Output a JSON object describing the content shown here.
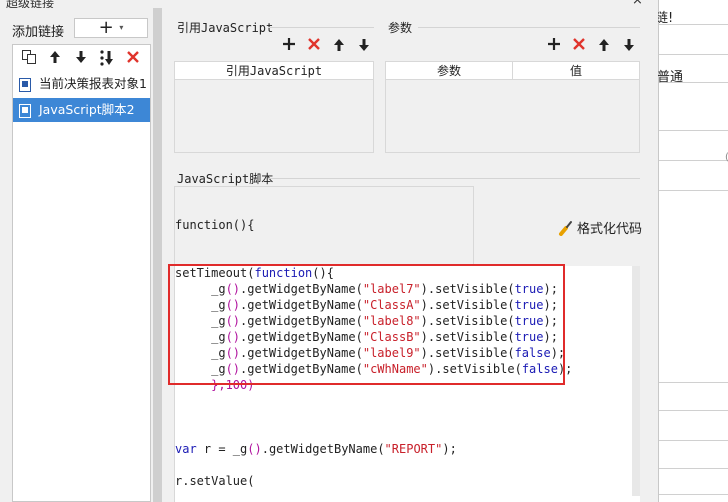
{
  "window": {
    "title": "超级链接",
    "close_symbol": "×"
  },
  "left": {
    "add_link_label": "添加链接",
    "add_button_symbol": "+",
    "add_button_caret": "▾",
    "items": [
      {
        "label": "当前决策报表对象1",
        "selected": false
      },
      {
        "label": "JavaScript脚本2",
        "selected": true
      }
    ]
  },
  "ref_js": {
    "section_label": "引用JavaScript",
    "column_header": "引用JavaScript"
  },
  "params": {
    "section_label": "参数",
    "col_param": "参数",
    "col_value": "值"
  },
  "script": {
    "section_label": "JavaScript脚本",
    "function_header": "function(){",
    "format_button": "格式化代码"
  },
  "code_lines": [
    {
      "segments": [
        {
          "t": "setTimeout(",
          "c": ""
        },
        {
          "t": "function",
          "c": "kw"
        },
        {
          "t": "(){",
          "c": ""
        }
      ]
    },
    {
      "segments": [
        {
          "t": "     _g",
          "c": ""
        },
        {
          "t": "()",
          "c": "pink"
        },
        {
          "t": ".getWidgetByName(",
          "c": ""
        },
        {
          "t": "\"label7\"",
          "c": "str"
        },
        {
          "t": ").setVisible(",
          "c": ""
        },
        {
          "t": "true",
          "c": "kw"
        },
        {
          "t": ");",
          "c": ""
        }
      ]
    },
    {
      "segments": [
        {
          "t": "     _g",
          "c": ""
        },
        {
          "t": "()",
          "c": "pink"
        },
        {
          "t": ".getWidgetByName(",
          "c": ""
        },
        {
          "t": "\"ClassA\"",
          "c": "str"
        },
        {
          "t": ").setVisible(",
          "c": ""
        },
        {
          "t": "true",
          "c": "kw"
        },
        {
          "t": ");",
          "c": ""
        }
      ]
    },
    {
      "segments": [
        {
          "t": "     _g",
          "c": ""
        },
        {
          "t": "()",
          "c": "pink"
        },
        {
          "t": ".getWidgetByName(",
          "c": ""
        },
        {
          "t": "\"label8\"",
          "c": "str"
        },
        {
          "t": ").setVisible(",
          "c": ""
        },
        {
          "t": "true",
          "c": "kw"
        },
        {
          "t": ");",
          "c": ""
        }
      ]
    },
    {
      "segments": [
        {
          "t": "     _g",
          "c": ""
        },
        {
          "t": "()",
          "c": "pink"
        },
        {
          "t": ".getWidgetByName(",
          "c": ""
        },
        {
          "t": "\"ClassB\"",
          "c": "str"
        },
        {
          "t": ").setVisible(",
          "c": ""
        },
        {
          "t": "true",
          "c": "kw"
        },
        {
          "t": ");",
          "c": ""
        }
      ]
    },
    {
      "segments": [
        {
          "t": "     _g",
          "c": ""
        },
        {
          "t": "()",
          "c": "pink"
        },
        {
          "t": ".getWidgetByName(",
          "c": ""
        },
        {
          "t": "\"label9\"",
          "c": "str"
        },
        {
          "t": ").setVisible(",
          "c": ""
        },
        {
          "t": "false",
          "c": "kw"
        },
        {
          "t": ");",
          "c": ""
        }
      ]
    },
    {
      "segments": [
        {
          "t": "     _g",
          "c": ""
        },
        {
          "t": "()",
          "c": "pink"
        },
        {
          "t": ".getWidgetByName(",
          "c": ""
        },
        {
          "t": "\"cWhName\"",
          "c": "str"
        },
        {
          "t": ").setVisible(",
          "c": ""
        },
        {
          "t": "false",
          "c": "kw"
        },
        {
          "t": ");",
          "c": ""
        }
      ]
    },
    {
      "segments": [
        {
          "t": "     },100)",
          "c": "pink"
        }
      ]
    },
    {
      "segments": []
    },
    {
      "segments": []
    },
    {
      "segments": []
    },
    {
      "segments": [
        {
          "t": "var",
          "c": "kw"
        },
        {
          "t": " r = _g",
          "c": ""
        },
        {
          "t": "()",
          "c": "pink"
        },
        {
          "t": ".getWidgetByName(",
          "c": ""
        },
        {
          "t": "\"REPORT\"",
          "c": "str"
        },
        {
          "t": ");",
          "c": ""
        }
      ]
    },
    {
      "segments": []
    },
    {
      "segments": [
        {
          "t": "r.setValue(",
          "c": ""
        }
      ]
    }
  ],
  "background_app": {
    "text_1": "链!",
    "text_2": "普通"
  },
  "colors": {
    "selection": "#3d87d6",
    "highlight_border": "#e02b2b",
    "keyword": "#1a1ab4",
    "string": "#c8202a"
  }
}
